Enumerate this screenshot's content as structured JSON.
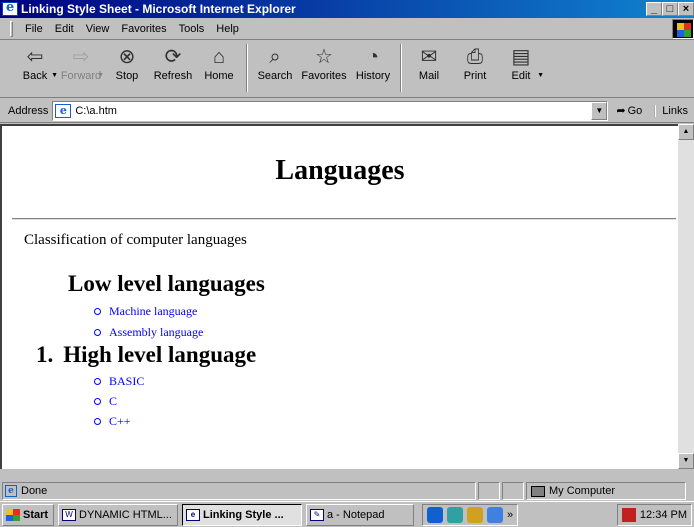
{
  "window": {
    "title": "Linking Style Sheet - Microsoft Internet Explorer",
    "buttons": [
      "_",
      "□",
      "×"
    ]
  },
  "menu": [
    "File",
    "Edit",
    "View",
    "Favorites",
    "Tools",
    "Help"
  ],
  "toolbar": {
    "back": "Back",
    "forward": "Forward",
    "stop": "Stop",
    "refresh": "Refresh",
    "home": "Home",
    "search": "Search",
    "favorites": "Favorites",
    "history": "History",
    "mail": "Mail",
    "print": "Print",
    "edit": "Edit"
  },
  "address": {
    "label": "Address",
    "value": "C:\\a.htm",
    "go": "Go",
    "links": "Links"
  },
  "page": {
    "title": "Languages",
    "intro": "Classification of computer languages",
    "low": {
      "heading": "Low level languages",
      "items": [
        "Machine language",
        "Assembly language"
      ]
    },
    "high": {
      "number": "1.",
      "heading": "High level language",
      "items": [
        "BASIC",
        "C",
        "C++"
      ]
    }
  },
  "status": {
    "text": "Done",
    "zone": "My Computer"
  },
  "taskbar": {
    "start": "Start",
    "tasks": [
      "DYNAMIC HTML...",
      "Linking Style ...",
      "a - Notepad"
    ],
    "clock": "12:34 PM"
  }
}
